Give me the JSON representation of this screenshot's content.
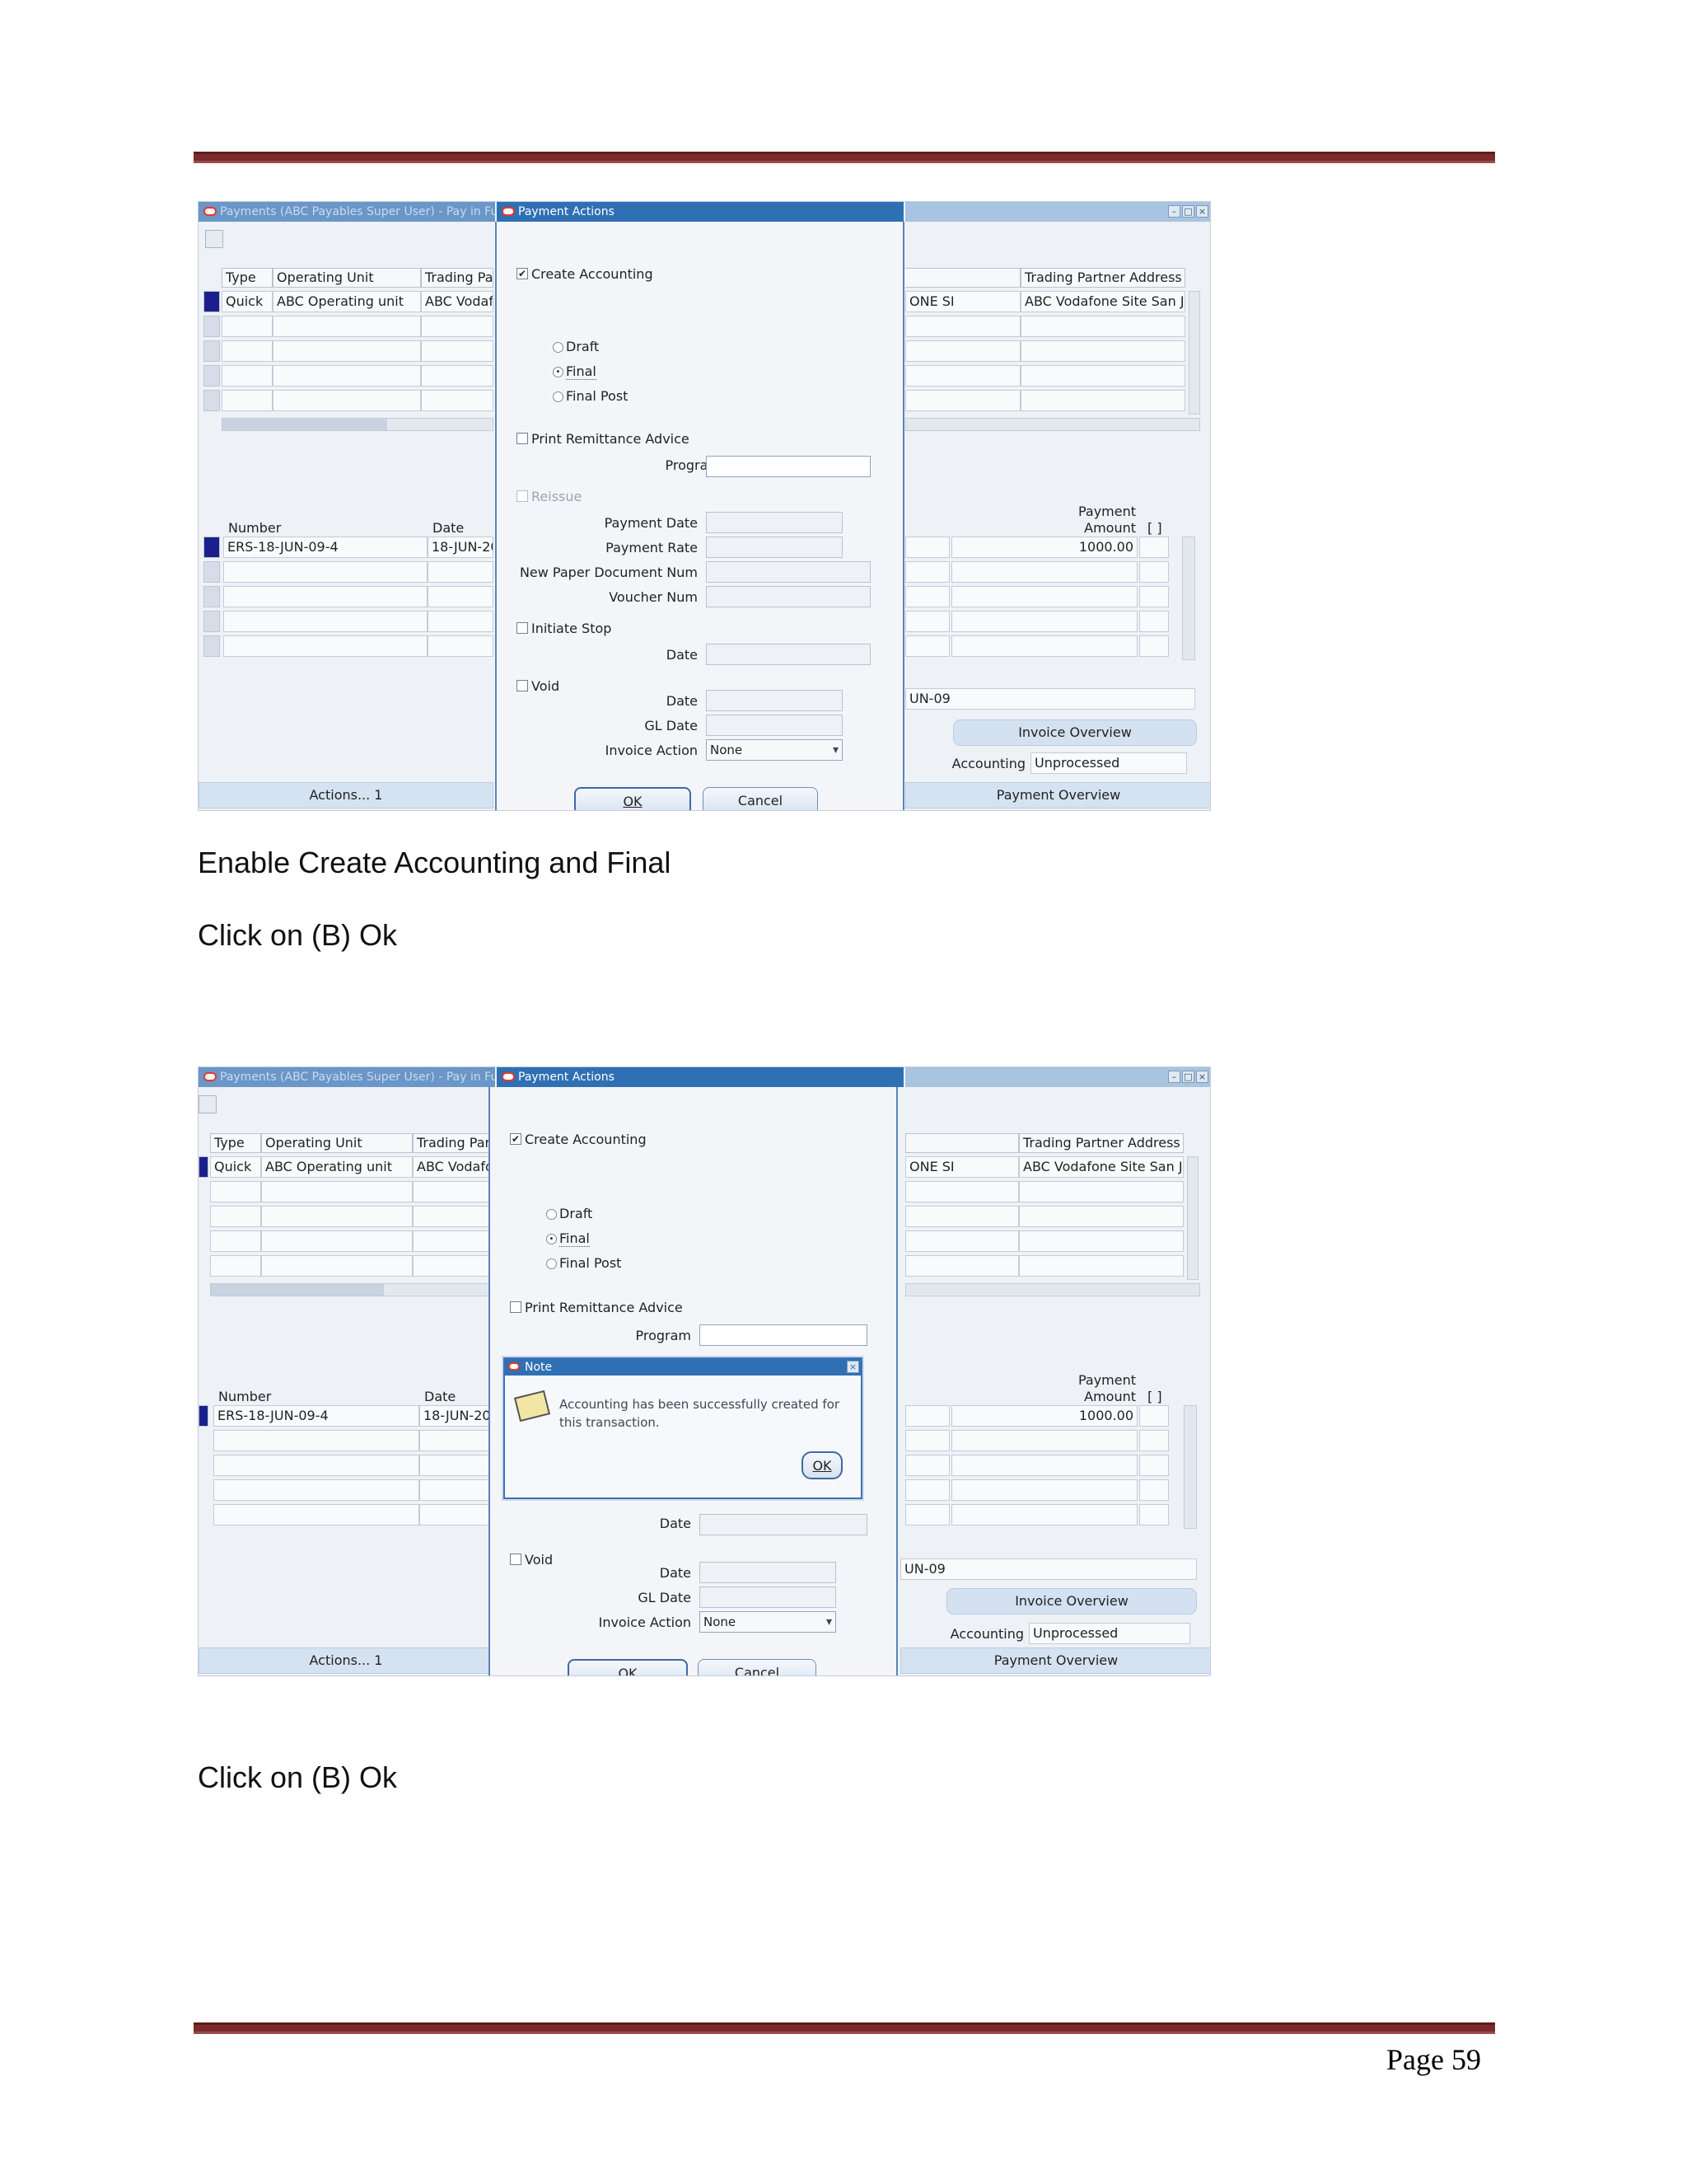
{
  "page": {
    "caption1": "Enable Create Accounting and Final",
    "caption2": "Click on (B) Ok",
    "caption3": "Click on (B) Ok",
    "page_number": "Page 59"
  },
  "shot": {
    "back_title": "Payments (ABC Payables Super User) - Pay in Full",
    "dialog_title": "Payment Actions",
    "note_title": "Note",
    "note_message": "Accounting has been successfully created for this transaction.",
    "note_ok": "OK",
    "header_cols": {
      "type": "Type",
      "operating_unit": "Operating Unit",
      "trading_partner": "Trading Part",
      "trading_partner_address": "Trading Partner Address"
    },
    "header_row": {
      "type": "Quick",
      "operating_unit": "ABC Operating unit",
      "trading_partner": "ABC Vodafo",
      "partial_col": "ONE SI",
      "address": "ABC Vodafone Site  San J"
    },
    "inv_cols": {
      "number": "Number",
      "date": "Date",
      "payment_amount_1": "Payment",
      "payment_amount_2": "Amount",
      "bracket": "[ ]"
    },
    "inv_row": {
      "number": "ERS-18-JUN-09-4",
      "date": "18-JUN-20",
      "amount": "1000.00"
    },
    "partial_date": "UN-09",
    "invoice_overview": "Invoice Overview",
    "accounting_label": "Accounting",
    "accounting_value": "Unprocessed",
    "actions": "Actions... 1",
    "payment_overview": "Payment Overview",
    "dialog": {
      "create_accounting": "Create Accounting",
      "draft": "Draft",
      "final": "Final",
      "final_post": "Final Post",
      "print_remittance": "Print Remittance Advice",
      "program": "Program",
      "reissue": "Reissue",
      "payment_date": "Payment Date",
      "payment_rate": "Payment Rate",
      "new_paper_doc": "New Paper Document Num",
      "voucher_num": "Voucher Num",
      "initiate_stop": "Initiate Stop",
      "date": "Date",
      "void": "Void",
      "gl_date": "GL Date",
      "invoice_action": "Invoice Action",
      "invoice_action_value": "None",
      "ok": "OK",
      "cancel": "Cancel"
    }
  },
  "colors": {
    "rule": "#7a2a2a",
    "title_active": "#2f70b4",
    "selected_row": "#1b1f8c"
  }
}
